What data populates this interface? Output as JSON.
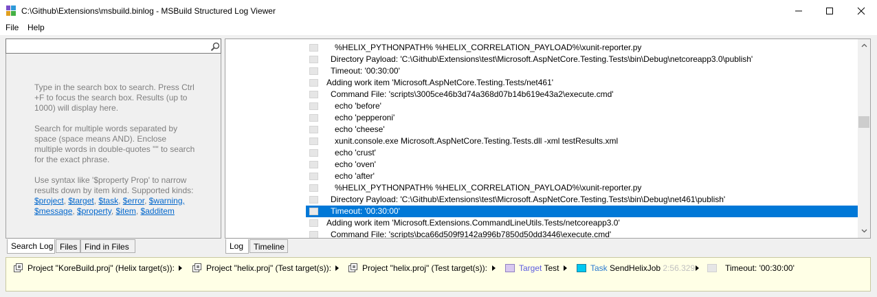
{
  "window": {
    "title": "C:\\Github\\Extensions\\msbuild.binlog - MSBuild Structured Log Viewer"
  },
  "menu": {
    "file": "File",
    "help": "Help"
  },
  "search": {
    "value": "",
    "placeholder": "",
    "help_p1": "Type in the search box to search. Press Ctrl +F to focus the search box. Results (up to 1000) will display here.",
    "help_p2": "Search for multiple words separated by space (space means AND). Enclose multiple words in double-quotes \"\" to search for the exact phrase.",
    "help_p3": "Use syntax like '$property Prop' to narrow results down by item kind. Supported kinds:",
    "kinds_line1": [
      "$project",
      "$target",
      "$task",
      "$error",
      "$warning,"
    ],
    "kinds_line2": [
      "$message",
      "$property",
      "$item",
      "$additem"
    ]
  },
  "left_tabs": [
    "Search Log",
    "Files",
    "Find in Files"
  ],
  "right_tabs": [
    "Log",
    "Timeline"
  ],
  "log_rows": [
    {
      "text": "%HELIX_PYTHONPATH% %HELIX_CORRELATION_PAYLOAD%\\xunit-reporter.py",
      "indent": 2
    },
    {
      "text": "Directory Payload: 'C:\\Github\\Extensions\\test\\Microsoft.AspNetCore.Testing.Tests\\bin\\Debug\\netcoreapp3.0\\publish'",
      "indent": 1
    },
    {
      "text": "Timeout: '00:30:00'",
      "indent": 1
    },
    {
      "text": "Adding work item 'Microsoft.AspNetCore.Testing.Tests/net461'",
      "indent": 0
    },
    {
      "text": "Command File: 'scripts\\3005ce46b3d74a368d07b14b619e43a2\\execute.cmd'",
      "indent": 1
    },
    {
      "text": "echo 'before'",
      "indent": 2
    },
    {
      "text": "echo 'pepperoni'",
      "indent": 2
    },
    {
      "text": "echo 'cheese'",
      "indent": 2
    },
    {
      "text": "xunit.console.exe Microsoft.AspNetCore.Testing.Tests.dll -xml testResults.xml",
      "indent": 2
    },
    {
      "text": "echo 'crust'",
      "indent": 2
    },
    {
      "text": "echo 'oven'",
      "indent": 2
    },
    {
      "text": "echo 'after'",
      "indent": 2
    },
    {
      "text": "%HELIX_PYTHONPATH% %HELIX_CORRELATION_PAYLOAD%\\xunit-reporter.py",
      "indent": 2
    },
    {
      "text": "Directory Payload: 'C:\\Github\\Extensions\\test\\Microsoft.AspNetCore.Testing.Tests\\bin\\Debug\\net461\\publish'",
      "indent": 1
    },
    {
      "text": "Timeout: '00:30:00'",
      "indent": 1,
      "selected": true
    },
    {
      "text": "Adding work item 'Microsoft.Extensions.CommandLineUtils.Tests/netcoreapp3.0'",
      "indent": 0
    },
    {
      "text": "Command File: 'scripts\\bca66d509f9142a996b7850d50dd3446\\execute.cmd'",
      "indent": 1
    }
  ],
  "breadcrumb": {
    "project1": "Project \"KoreBuild.proj\" (Helix target(s)):",
    "project2": "Project \"helix.proj\" (Test target(s)):",
    "project3": "Project \"helix.proj\" (Test target(s)):",
    "target_kind": "Target",
    "target_name": "Test",
    "task_kind": "Task",
    "task_name": "SendHelixJob",
    "task_duration": "2:56.329",
    "message": "Timeout: '00:30:00'"
  },
  "colors": {
    "selection": "#0078d7",
    "target_box": "#d8c8f0",
    "task_box": "#00c8f0",
    "breadcrumb_bg": "#ffffe6"
  }
}
